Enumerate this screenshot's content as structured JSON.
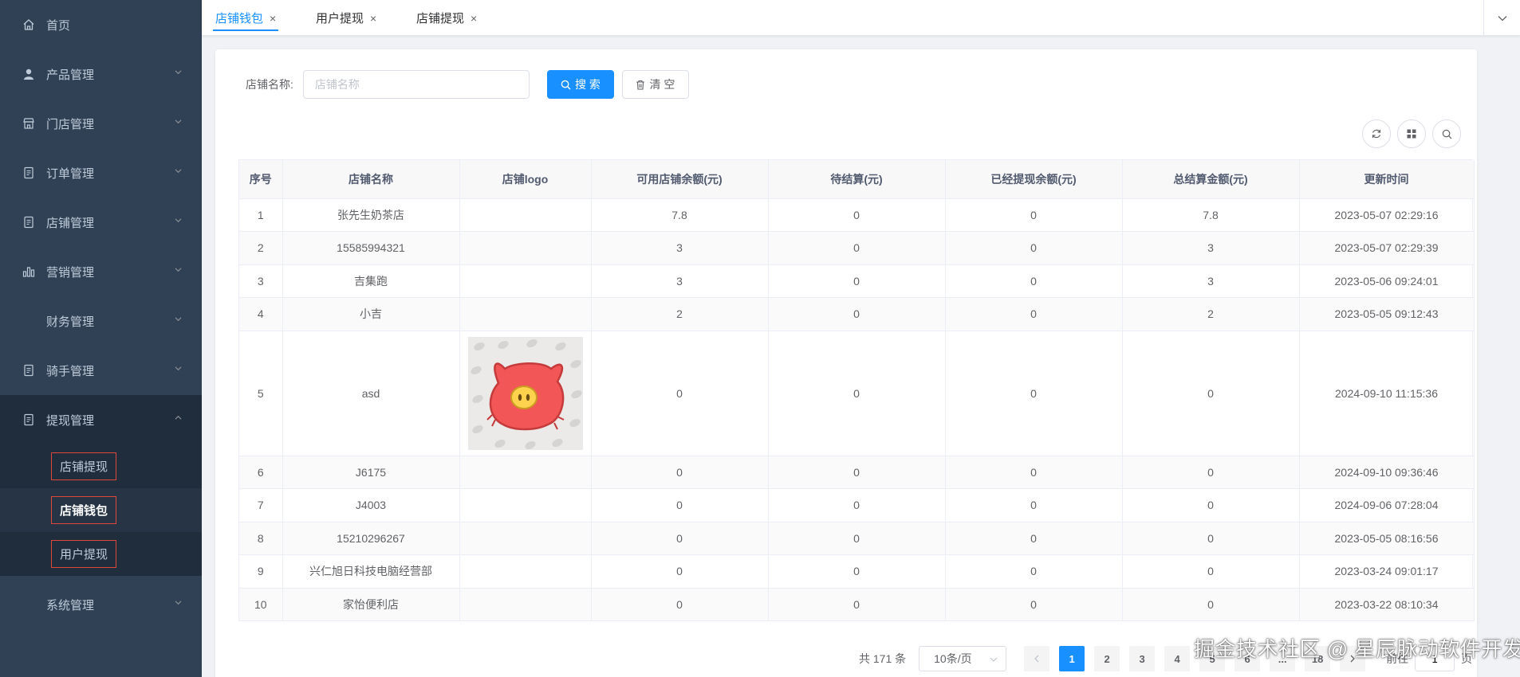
{
  "sidebar": {
    "items": [
      {
        "label": "首页",
        "icon": "home-icon"
      },
      {
        "label": "产品管理",
        "icon": "user-icon"
      },
      {
        "label": "门店管理",
        "icon": "shop-icon"
      },
      {
        "label": "订单管理",
        "icon": "document-icon"
      },
      {
        "label": "店铺管理",
        "icon": "document-icon"
      },
      {
        "label": "营销管理",
        "icon": "bar-chart-icon"
      },
      {
        "label": "财务管理",
        "icon": ""
      },
      {
        "label": "骑手管理",
        "icon": "document-icon"
      },
      {
        "label": "提现管理",
        "icon": "document-icon"
      }
    ],
    "submenu": [
      {
        "label": "店铺提现"
      },
      {
        "label": "店铺钱包"
      },
      {
        "label": "用户提现"
      }
    ],
    "last_item": {
      "label": "系统管理"
    }
  },
  "tabs": [
    {
      "label": "店铺钱包",
      "close": "×"
    },
    {
      "label": "用户提现",
      "close": "×"
    },
    {
      "label": "店铺提现",
      "close": "×"
    }
  ],
  "search": {
    "label": "店铺名称:",
    "placeholder": "店铺名称",
    "search_button": "搜 索",
    "clear_button": "清 空"
  },
  "table": {
    "headers": [
      "序号",
      "店铺名称",
      "店铺logo",
      "可用店铺余额(元)",
      "待结算(元)",
      "已经提现余额(元)",
      "总结算金额(元)",
      "更新时间"
    ],
    "rows": [
      {
        "no": "1",
        "name": "张先生奶茶店",
        "available": "7.8",
        "pending": "0",
        "withdrawn": "0",
        "total": "7.8",
        "time": "2023-05-07 02:29:16"
      },
      {
        "no": "2",
        "name": "15585994321",
        "available": "3",
        "pending": "0",
        "withdrawn": "0",
        "total": "3",
        "time": "2023-05-07 02:29:39"
      },
      {
        "no": "3",
        "name": "吉集跑",
        "available": "3",
        "pending": "0",
        "withdrawn": "0",
        "total": "3",
        "time": "2023-05-06 09:24:01"
      },
      {
        "no": "4",
        "name": "小吉",
        "available": "2",
        "pending": "0",
        "withdrawn": "0",
        "total": "2",
        "time": "2023-05-05 09:12:43"
      },
      {
        "no": "5",
        "name": "asd",
        "available": "0",
        "pending": "0",
        "withdrawn": "0",
        "total": "0",
        "time": "2024-09-10 11:15:36"
      },
      {
        "no": "6",
        "name": "J6175",
        "available": "0",
        "pending": "0",
        "withdrawn": "0",
        "total": "0",
        "time": "2024-09-10 09:36:46"
      },
      {
        "no": "7",
        "name": "J4003",
        "available": "0",
        "pending": "0",
        "withdrawn": "0",
        "total": "0",
        "time": "2024-09-06 07:28:04"
      },
      {
        "no": "8",
        "name": "15210296267",
        "available": "0",
        "pending": "0",
        "withdrawn": "0",
        "total": "0",
        "time": "2023-05-05 08:16:56"
      },
      {
        "no": "9",
        "name": "兴仁旭日科技电脑经营部",
        "available": "0",
        "pending": "0",
        "withdrawn": "0",
        "total": "0",
        "time": "2023-03-24 09:01:17"
      },
      {
        "no": "10",
        "name": "家怡便利店",
        "available": "0",
        "pending": "0",
        "withdrawn": "0",
        "total": "0",
        "time": "2023-03-22 08:10:34"
      }
    ]
  },
  "pagination": {
    "total_text": "共 171 条",
    "page_size": "10条/页",
    "pages": [
      "1",
      "2",
      "3",
      "4",
      "5",
      "6",
      "...",
      "18"
    ],
    "current": "1",
    "goto_label": "前往",
    "goto_value": "1",
    "page_suffix": "页"
  },
  "watermark": "掘金技术社区 @ 星辰脉动软件开发",
  "colors": {
    "sidebar_bg": "#304156",
    "primary": "#1890ff",
    "highlight_border": "#e0493a"
  }
}
